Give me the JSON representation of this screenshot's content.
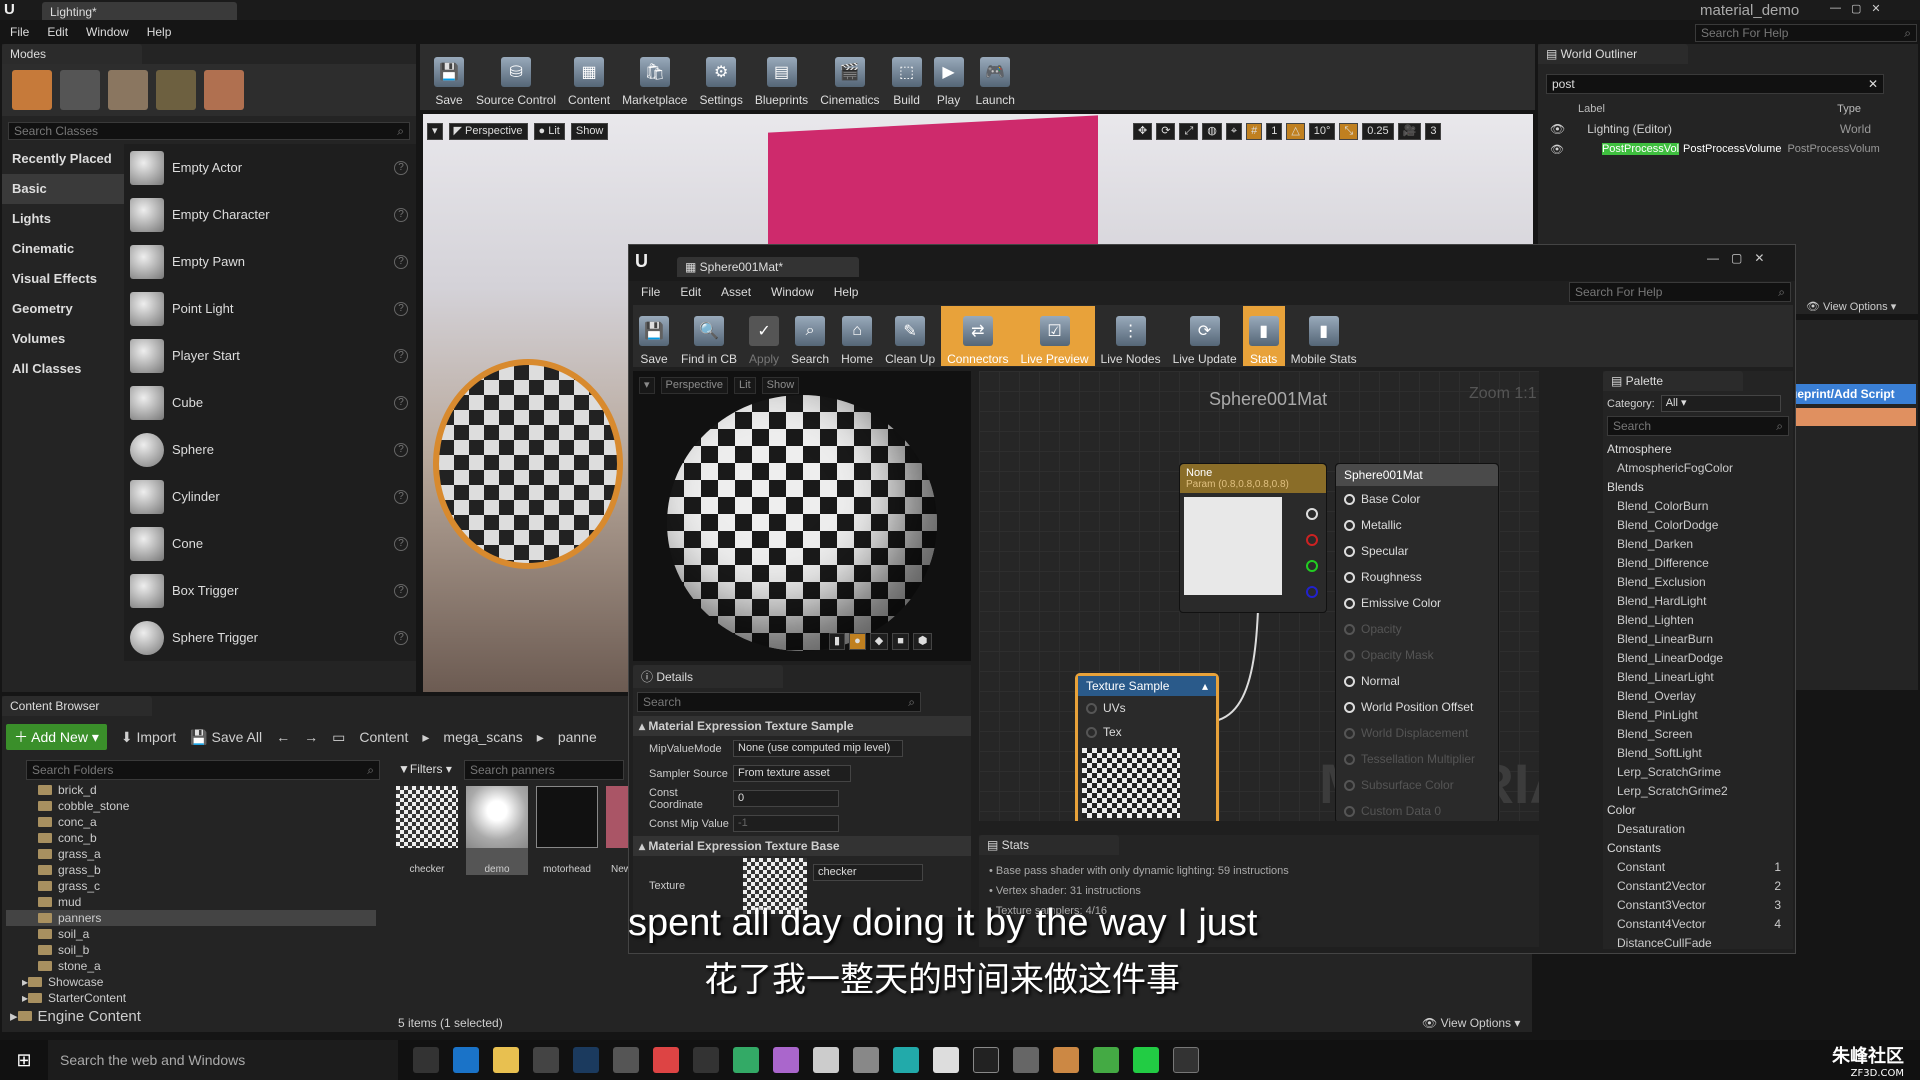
{
  "main": {
    "tab_title": "Lighting*",
    "project_name": "material_demo",
    "search_help": "Search For Help",
    "menu": [
      "File",
      "Edit",
      "Window",
      "Help"
    ]
  },
  "modes": {
    "title": "Modes",
    "search_placeholder": "Search Classes",
    "categories": [
      "Recently Placed",
      "Basic",
      "Lights",
      "Cinematic",
      "Visual Effects",
      "Geometry",
      "Volumes",
      "All Classes"
    ],
    "items": [
      "Empty Actor",
      "Empty Character",
      "Empty Pawn",
      "Point Light",
      "Player Start",
      "Cube",
      "Sphere",
      "Cylinder",
      "Cone",
      "Box Trigger",
      "Sphere Trigger"
    ]
  },
  "toolbar": {
    "buttons": [
      "Save",
      "Source Control",
      "Content",
      "Marketplace",
      "Settings",
      "Blueprints",
      "Cinematics",
      "Build",
      "Play",
      "Launch"
    ]
  },
  "viewport": {
    "perspective": "Perspective",
    "lit": "Lit",
    "show": "Show",
    "grid_snap": "10",
    "rot_snap": "10°",
    "scale_snap": "0.25",
    "cam_speed": "3",
    "grid_num": "1"
  },
  "outliner": {
    "title": "World Outliner",
    "search_value": "post",
    "col_label": "Label",
    "col_type": "Type",
    "rows": [
      {
        "label": "Lighting (Editor)",
        "type": "World"
      },
      {
        "label": "PostProcessVol",
        "label2": "PostProcessVolume",
        "type": "PostProcessVolum"
      }
    ],
    "view_options": "View Options"
  },
  "details_main": {
    "script_button": "Blueprint/Add Script"
  },
  "content_browser": {
    "title": "Content Browser",
    "add_new": "Add New",
    "import": "Import",
    "save_all": "Save All",
    "path": [
      "Content",
      "mega_scans",
      "panne"
    ],
    "search_folders": "Search Folders",
    "filters": "Filters",
    "search_assets": "Search panners",
    "folders": [
      "brick_d",
      "cobble_stone",
      "conc_a",
      "conc_b",
      "grass_a",
      "grass_b",
      "grass_c",
      "mud",
      "panners",
      "soil_a",
      "soil_b",
      "stone_a"
    ],
    "showcase": "Showcase",
    "starter": "StarterContent",
    "engine": "Engine Content",
    "assets": [
      "checker",
      "demo",
      "motorhead",
      "New"
    ],
    "status": "5 items (1 selected)",
    "view_options": "View Options"
  },
  "mat_editor": {
    "tab": "Sphere001Mat*",
    "search_help": "Search For Help",
    "menu": [
      "File",
      "Edit",
      "Asset",
      "Window",
      "Help"
    ],
    "toolbar": [
      "Save",
      "Find in CB",
      "Apply",
      "Search",
      "Home",
      "Clean Up",
      "Connectors",
      "Live Preview",
      "Live Nodes",
      "Live Update",
      "Stats",
      "Mobile Stats"
    ],
    "preview": {
      "perspective": "Perspective",
      "lit": "Lit",
      "show": "Show"
    },
    "graph_title": "Sphere001Mat",
    "zoom": "Zoom 1:1",
    "watermark": "MATERIAL",
    "param_node": {
      "title": "None",
      "subtitle": "Param (0.8,0.8,0.8,0.8)"
    },
    "result_node": {
      "title": "Sphere001Mat",
      "pins": [
        "Base Color",
        "Metallic",
        "Specular",
        "Roughness",
        "Emissive Color",
        "Opacity",
        "Opacity Mask",
        "Normal",
        "World Position Offset",
        "World Displacement",
        "Tessellation Multiplier",
        "Subsurface Color",
        "Custom Data 0"
      ]
    },
    "tex_node": {
      "title": "Texture Sample",
      "pins": [
        "UVs",
        "Tex"
      ]
    },
    "details": {
      "title": "Details",
      "search": "Search",
      "section1": "Material Expression Texture Sample",
      "rows": [
        {
          "label": "MipValueMode",
          "value": "None (use computed mip level)"
        },
        {
          "label": "Sampler Source",
          "value": "From texture asset"
        },
        {
          "label": "Const Coordinate",
          "value": "0"
        },
        {
          "label": "Const Mip Value",
          "value": "-1"
        }
      ],
      "section2": "Material Expression Texture Base",
      "texture_label": "Texture",
      "texture_value": "checker"
    },
    "stats": {
      "title": "Stats",
      "lines": [
        "Base pass shader with only dynamic lighting: 59 instructions",
        "Vertex shader: 31 instructions",
        "Texture samplers: 4/16"
      ]
    },
    "palette": {
      "title": "Palette",
      "category_label": "Category:",
      "category_value": "All",
      "search": "Search",
      "groups": [
        {
          "name": "Atmosphere",
          "items": [
            {
              "n": "AtmosphericFogColor",
              "k": ""
            }
          ]
        },
        {
          "name": "Blends",
          "items": [
            {
              "n": "Blend_ColorBurn",
              "k": ""
            },
            {
              "n": "Blend_ColorDodge",
              "k": ""
            },
            {
              "n": "Blend_Darken",
              "k": ""
            },
            {
              "n": "Blend_Difference",
              "k": ""
            },
            {
              "n": "Blend_Exclusion",
              "k": ""
            },
            {
              "n": "Blend_HardLight",
              "k": ""
            },
            {
              "n": "Blend_Lighten",
              "k": ""
            },
            {
              "n": "Blend_LinearBurn",
              "k": ""
            },
            {
              "n": "Blend_LinearDodge",
              "k": ""
            },
            {
              "n": "Blend_LinearLight",
              "k": ""
            },
            {
              "n": "Blend_Overlay",
              "k": ""
            },
            {
              "n": "Blend_PinLight",
              "k": ""
            },
            {
              "n": "Blend_Screen",
              "k": ""
            },
            {
              "n": "Blend_SoftLight",
              "k": ""
            },
            {
              "n": "Lerp_ScratchGrime",
              "k": ""
            },
            {
              "n": "Lerp_ScratchGrime2",
              "k": ""
            }
          ]
        },
        {
          "name": "Color",
          "items": [
            {
              "n": "Desaturation",
              "k": ""
            }
          ]
        },
        {
          "name": "Constants",
          "items": [
            {
              "n": "Constant",
              "k": "1"
            },
            {
              "n": "Constant2Vector",
              "k": "2"
            },
            {
              "n": "Constant3Vector",
              "k": "3"
            },
            {
              "n": "Constant4Vector",
              "k": "4"
            },
            {
              "n": "DistanceCullFade",
              "k": ""
            }
          ]
        }
      ]
    }
  },
  "subtitles": {
    "en": "spent all day doing it by the way I just",
    "zh": "花了我一整天的时间来做这件事"
  },
  "taskbar": {
    "search": "Search the web and Windows",
    "watermark": "朱峰社区",
    "time": "ZF3D.COM"
  },
  "colors": {
    "accent_orange": "#e8a23a",
    "highlight_green": "#3fbf3f",
    "node_red": "#8b1c1c"
  }
}
